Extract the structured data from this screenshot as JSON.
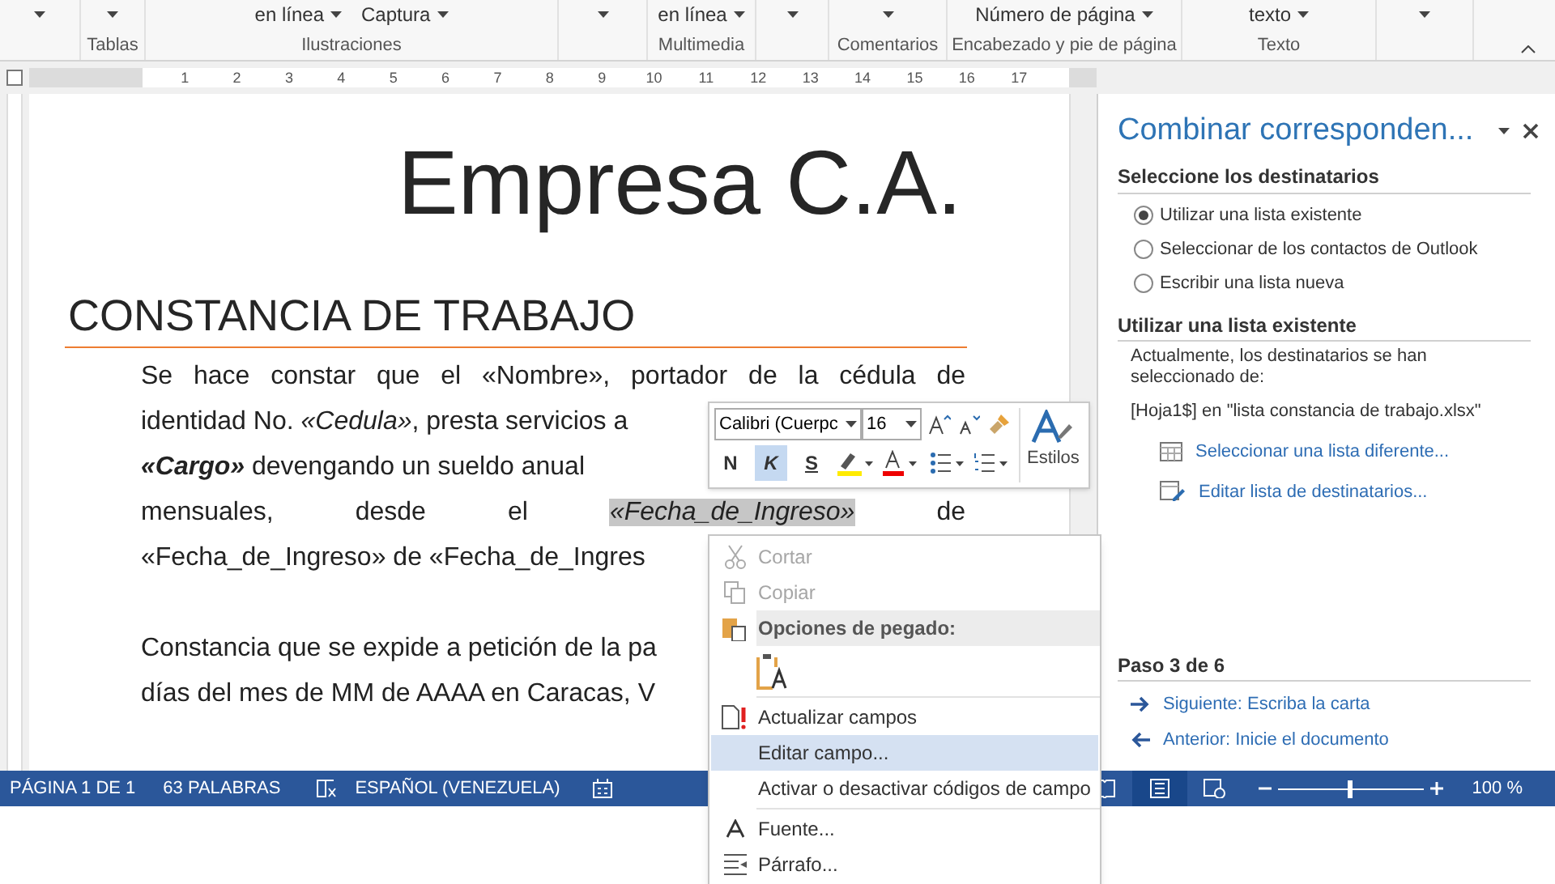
{
  "ribbon": {
    "groups": [
      {
        "label": "Tablas"
      },
      {
        "label": "Ilustraciones",
        "buttons": [
          "en línea",
          "Captura"
        ]
      },
      {
        "label": "Multimedia",
        "buttons": [
          "en línea"
        ]
      },
      {
        "label": "Comentarios"
      },
      {
        "label": "Encabezado y pie de página",
        "buttons": [
          "Número de página"
        ]
      },
      {
        "label": "Texto",
        "buttons": [
          "texto"
        ]
      }
    ]
  },
  "ruler": {
    "ticks": [
      "1",
      "2",
      "3",
      "4",
      "5",
      "6",
      "7",
      "8",
      "9",
      "10",
      "11",
      "12",
      "13",
      "14",
      "15",
      "16",
      "17"
    ]
  },
  "document": {
    "title": "Empresa C.A.",
    "heading": "CONSTANCIA DE TRABAJO",
    "lines": [
      {
        "kind": "justified",
        "segments": [
          {
            "text": "Se hace constar que el «Nombre», portador de la cédula de",
            "kind": "text",
            "selected": false
          }
        ]
      },
      {
        "kind": "cut",
        "segments": [
          {
            "text": "identidad No. ",
            "kind": "text",
            "selected": false
          },
          {
            "text": "«Cedula»",
            "kind": "field",
            "selected": false
          },
          {
            "text": ", presta servicios a",
            "kind": "text",
            "selected": false
          }
        ]
      },
      {
        "kind": "cut",
        "segments": [
          {
            "text": "«Cargo»",
            "kind": "strong-field",
            "selected": false
          },
          {
            "text": " devengando un sueldo anual",
            "kind": "text",
            "selected": false
          }
        ]
      },
      {
        "kind": "justified",
        "segments": [
          {
            "text": "mensuales, desde el ",
            "kind": "text",
            "selected": false
          },
          {
            "text": "«Fecha_de_Ingreso»",
            "kind": "field",
            "selected": true
          },
          {
            "text": " de",
            "kind": "text",
            "selected": false
          }
        ]
      },
      {
        "kind": "cut",
        "segments": [
          {
            "text": "«Fecha_de_Ingreso» de «Fecha_de_Ingres",
            "kind": "text",
            "selected": false
          }
        ]
      },
      {
        "kind": "blank"
      },
      {
        "kind": "cut",
        "segments": [
          {
            "text": "Constancia que se expide a petición de la pa",
            "kind": "text",
            "selected": false
          }
        ]
      },
      {
        "kind": "cut",
        "segments": [
          {
            "text": "días del mes de MM de AAAA en Caracas, V",
            "kind": "text",
            "selected": false
          }
        ]
      }
    ]
  },
  "mini_toolbar": {
    "font": "Calibri (Cuerpc",
    "size": "16",
    "format_buttons": [
      {
        "label": "N",
        "selected": false
      },
      {
        "label": "K",
        "selected": true
      },
      {
        "label": "S",
        "selected": false
      }
    ],
    "styles": "Estilos"
  },
  "context_menu": {
    "items": [
      {
        "kind": "item",
        "label": "Cortar",
        "disabled": true,
        "selected": false
      },
      {
        "kind": "item",
        "label": "Copiar",
        "disabled": true,
        "selected": false
      },
      {
        "kind": "header",
        "label": "Opciones de pegado:"
      },
      {
        "kind": "paste"
      },
      {
        "kind": "separator"
      },
      {
        "kind": "item",
        "label": "Actualizar campos",
        "disabled": false,
        "selected": false
      },
      {
        "kind": "item",
        "label": "Editar campo...",
        "disabled": false,
        "selected": true
      },
      {
        "kind": "item",
        "label": "Activar o desactivar códigos de campo",
        "disabled": false,
        "selected": false
      },
      {
        "kind": "separator"
      },
      {
        "kind": "item",
        "label": "Fuente...",
        "disabled": false,
        "selected": false
      },
      {
        "kind": "item",
        "label": "Párrafo...",
        "disabled": false,
        "selected": false
      }
    ]
  },
  "task_pane": {
    "title": "Combinar corresponden...",
    "recipients_heading": "Seleccione los destinatarios",
    "options": [
      {
        "label": "Utilizar una lista existente",
        "selected": true
      },
      {
        "label": "Seleccionar de los contactos de Outlook",
        "selected": false
      },
      {
        "label": "Escribir una lista nueva",
        "selected": false
      }
    ],
    "existing_heading": "Utilizar una lista existente",
    "description": "Actualmente, los destinatarios se han seleccionado de:",
    "source": "[Hoja1$] en \"lista constancia de trabajo.xlsx\"",
    "links": [
      {
        "kind": "table",
        "label": "Seleccionar una lista diferente..."
      },
      {
        "kind": "edit",
        "label": "Editar lista de destinatarios..."
      }
    ],
    "step": "Paso 3 de 6",
    "nav": [
      {
        "kind": "next",
        "label": "Siguiente: Escriba la carta"
      },
      {
        "kind": "previous",
        "label": "Anterior: Inicie el documento"
      }
    ]
  },
  "status_bar": {
    "page": "PÁGINA 1 DE 1",
    "words": "63 PALABRAS",
    "language": "ESPAÑOL (VENEZUELA)",
    "views": [
      {
        "selected": false
      },
      {
        "selected": true
      },
      {
        "selected": false
      }
    ],
    "zoom": {
      "level": 0.5,
      "label": "100 %"
    }
  }
}
